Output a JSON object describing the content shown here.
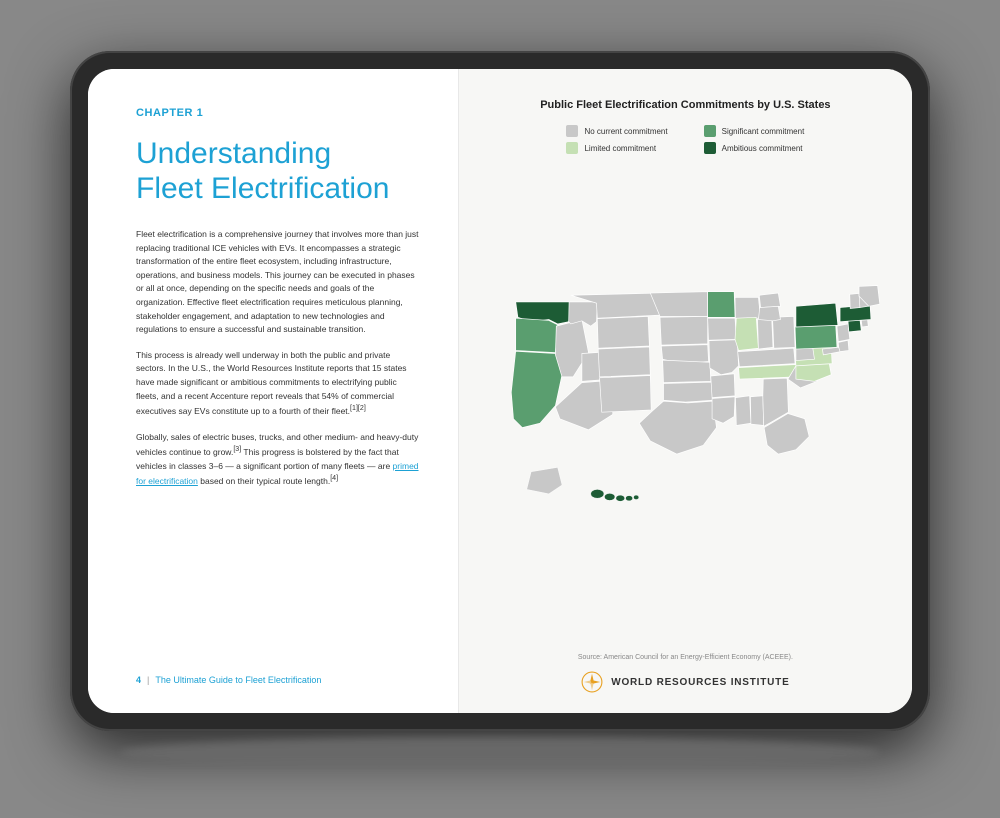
{
  "tablet": {
    "left_page": {
      "chapter_label": "CHAPTER 1",
      "chapter_title": "Understanding\nFleet Electrification",
      "paragraphs": [
        "Fleet electrification is a comprehensive journey that involves more than just replacing traditional ICE vehicles with EVs. It encompasses a strategic transformation of the entire fleet ecosystem, including infrastructure, operations, and business models. This journey can be executed in phases or all at once, depending on the specific needs and goals of the organization. Effective fleet electrification requires meticulous planning, stakeholder engagement, and adaptation to new technologies and regulations to ensure a successful and sustainable transition.",
        "This process is already well underway in both the public and private sectors. In the U.S., the World Resources Institute reports that 15 states have made significant or ambitious commitments to electrifying public fleets, and a recent Accenture report reveals that 54% of commercial executives say EVs constitute up to a fourth of their fleet.[1][2]",
        "Globally, sales of electric buses, trucks, and other medium- and heavy-duty vehicles continue to grow.[3] This progress is bolstered by the fact that vehicles in classes 3–6 — a significant portion of many fleets — are primed for electrification based on their typical route length.[4]"
      ],
      "link_text": "primed for electrification",
      "footer_page": "4",
      "footer_title": "The Ultimate Guide to Fleet Electrification"
    },
    "right_page": {
      "map_title": "Public Fleet Electrification Commitments by U.S. States",
      "legend": [
        {
          "label": "No current commitment",
          "color": "#c8c8c8"
        },
        {
          "label": "Significant commitment",
          "color": "#5a9e6f"
        },
        {
          "label": "Limited commitment",
          "color": "#c5e0b4"
        },
        {
          "label": "Ambitious commitment",
          "color": "#1d5c35"
        }
      ],
      "source": "Source: American Council for an Energy-Efficient Economy (ACEEE).",
      "wri_label": "WORLD RESOURCES INSTITUTE"
    }
  }
}
